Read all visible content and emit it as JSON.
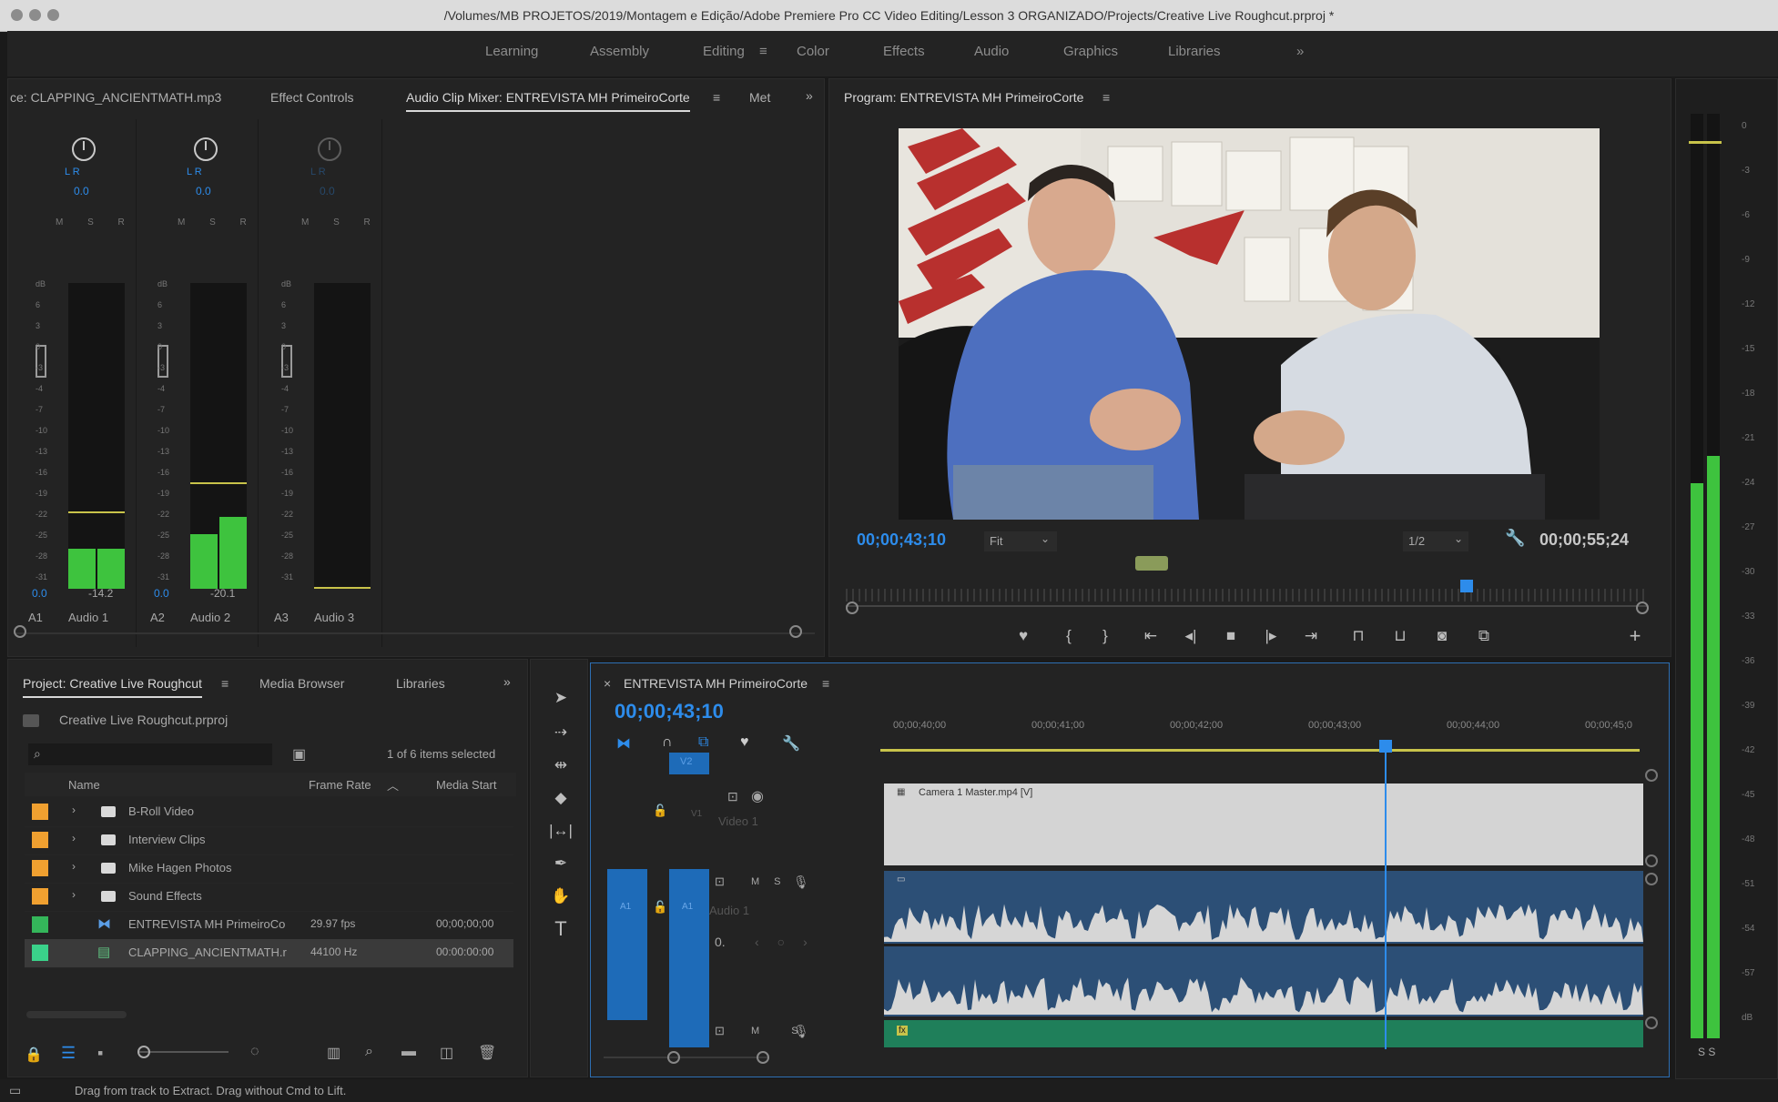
{
  "window": {
    "title": "/Volumes/MB PROJETOS/2019/Montagem e Edição/Adobe Premiere Pro CC Video Editing/Lesson 3 ORGANIZADO/Projects/Creative Live Roughcut.prproj *"
  },
  "workspaces": {
    "items": [
      "Learning",
      "Assembly",
      "Editing",
      "Color",
      "Effects",
      "Audio",
      "Graphics",
      "Libraries"
    ],
    "active": "Editing",
    "more": "»"
  },
  "source_panel": {
    "tabs": [
      "ce: CLAPPING_ANCIENTMATH.mp3",
      "Effect Controls",
      "Audio Clip Mixer: ENTREVISTA MH PrimeiroCorte",
      "Met"
    ],
    "menu_icon": "≡",
    "more": "»"
  },
  "mixer": {
    "channels": [
      {
        "pan_label": "L R",
        "pan_value": "0.0",
        "msr": "M S R",
        "db_left": "0.0",
        "db_right": "-14.2",
        "track_id": "A1",
        "track_name": "Audio 1",
        "level": 0.13
      },
      {
        "pan_label": "L R",
        "pan_value": "0.0",
        "msr": "M S R",
        "db_left": "0.0",
        "db_right": "-20.1",
        "track_id": "A2",
        "track_name": "Audio 2",
        "level": 0.18
      },
      {
        "pan_label": "L R",
        "pan_value": "0.0",
        "msr": "M S R",
        "db_left": "",
        "db_right": "",
        "track_id": "A3",
        "track_name": "Audio 3",
        "level": 0
      }
    ],
    "scale": [
      "dB",
      "6",
      "3",
      "0",
      "-3",
      "-4",
      "-7",
      "-10",
      "-13",
      "-16",
      "-19",
      "-22",
      "-25",
      "-28",
      "-31"
    ]
  },
  "program_monitor": {
    "tab": "Program: ENTREVISTA MH PrimeiroCorte",
    "menu_icon": "≡",
    "timecode": "00;00;43;10",
    "fit": "Fit",
    "resolution": "1/2",
    "duration": "00;00;55;24",
    "playhead_position": 0.78,
    "controls": [
      "marker-icon",
      "mark-in-icon",
      "mark-out-icon",
      "go-to-in-icon",
      "step-back-icon",
      "stop-icon",
      "step-forward-icon",
      "go-to-out-icon",
      "lift-icon",
      "extract-icon",
      "export-frame-icon",
      "comparison-view-icon",
      "add-icon"
    ]
  },
  "project_panel": {
    "tabs": [
      "Project: Creative Live Roughcut",
      "Media Browser",
      "Libraries"
    ],
    "menu_icon": "≡",
    "more": "»",
    "project_file": "Creative Live Roughcut.prproj",
    "search_placeholder": "",
    "selection_status": "1 of 6 items selected",
    "columns": [
      "Name",
      "Frame Rate",
      "Media Start"
    ],
    "items": [
      {
        "name": "B-Roll Video",
        "type": "folder",
        "color": "#f0a030",
        "frame_rate": "",
        "media_start": ""
      },
      {
        "name": "Interview Clips",
        "type": "folder",
        "color": "#f0a030",
        "frame_rate": "",
        "media_start": ""
      },
      {
        "name": "Mike Hagen Photos",
        "type": "folder",
        "color": "#f0a030",
        "frame_rate": "",
        "media_start": ""
      },
      {
        "name": "Sound Effects",
        "type": "folder",
        "color": "#f0a030",
        "frame_rate": "",
        "media_start": ""
      },
      {
        "name": "ENTREVISTA MH PrimeiroCo",
        "type": "sequence",
        "color": "#34b65a",
        "frame_rate": "29.97 fps",
        "media_start": "00;00;00;00"
      },
      {
        "name": "CLAPPING_ANCIENTMATH.r",
        "type": "audio",
        "color": "#3ad28a",
        "frame_rate": "44100 Hz",
        "media_start": "00:00:00:00"
      }
    ]
  },
  "tools": [
    "selection-tool-icon",
    "track-select-icon",
    "ripple-edit-icon",
    "razor-icon",
    "slip-icon",
    "pen-icon",
    "hand-icon",
    "type-icon"
  ],
  "timeline": {
    "tab": "ENTREVISTA MH PrimeiroCorte",
    "menu_icon": "≡",
    "timecode": "00;00;43;10",
    "ruler": [
      "00;00;40;00",
      "00;00;41;00",
      "00;00;42;00",
      "00;00;43;00",
      "00;00;44;00",
      "00;00;45;0"
    ],
    "tracks": {
      "v2": "V2",
      "v1_src": "V1",
      "v1": "V1",
      "v1_name": "Video 1",
      "a1_src": "A1",
      "a1": "A1",
      "a1_name": "Audio 1",
      "a1_level": "0.",
      "a2_controls": "M S"
    },
    "clip_name": "Camera 1 Master.mp4 [V]",
    "fx": "fx"
  },
  "audio_meter": {
    "scale": [
      "0",
      "-3",
      "-6",
      "-9",
      "-12",
      "-15",
      "-18",
      "-21",
      "-24",
      "-27",
      "-30",
      "-33",
      "-36",
      "-39",
      "-42",
      "-45",
      "-48",
      "-51",
      "-54",
      "-57",
      "dB"
    ],
    "solo": "S S",
    "left_level": 0.6,
    "right_level": 0.63
  },
  "status_bar": {
    "text": "Drag from track to Extract. Drag without Cmd to Lift."
  }
}
